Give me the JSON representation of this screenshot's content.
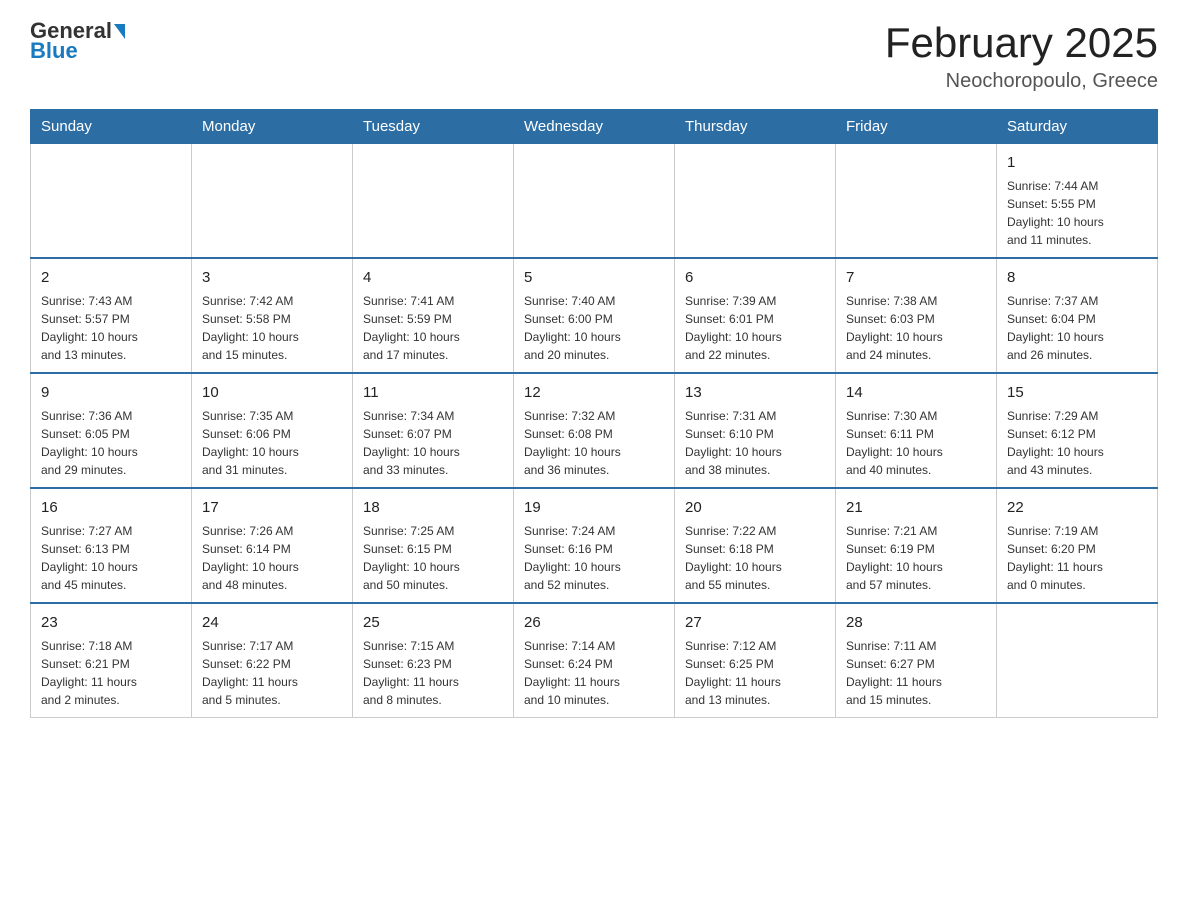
{
  "header": {
    "logo": {
      "general": "General",
      "blue": "Blue"
    },
    "title": "February 2025",
    "location": "Neochoropoulo, Greece"
  },
  "days_of_week": [
    "Sunday",
    "Monday",
    "Tuesday",
    "Wednesday",
    "Thursday",
    "Friday",
    "Saturday"
  ],
  "weeks": [
    [
      {
        "day": "",
        "info": ""
      },
      {
        "day": "",
        "info": ""
      },
      {
        "day": "",
        "info": ""
      },
      {
        "day": "",
        "info": ""
      },
      {
        "day": "",
        "info": ""
      },
      {
        "day": "",
        "info": ""
      },
      {
        "day": "1",
        "info": "Sunrise: 7:44 AM\nSunset: 5:55 PM\nDaylight: 10 hours\nand 11 minutes."
      }
    ],
    [
      {
        "day": "2",
        "info": "Sunrise: 7:43 AM\nSunset: 5:57 PM\nDaylight: 10 hours\nand 13 minutes."
      },
      {
        "day": "3",
        "info": "Sunrise: 7:42 AM\nSunset: 5:58 PM\nDaylight: 10 hours\nand 15 minutes."
      },
      {
        "day": "4",
        "info": "Sunrise: 7:41 AM\nSunset: 5:59 PM\nDaylight: 10 hours\nand 17 minutes."
      },
      {
        "day": "5",
        "info": "Sunrise: 7:40 AM\nSunset: 6:00 PM\nDaylight: 10 hours\nand 20 minutes."
      },
      {
        "day": "6",
        "info": "Sunrise: 7:39 AM\nSunset: 6:01 PM\nDaylight: 10 hours\nand 22 minutes."
      },
      {
        "day": "7",
        "info": "Sunrise: 7:38 AM\nSunset: 6:03 PM\nDaylight: 10 hours\nand 24 minutes."
      },
      {
        "day": "8",
        "info": "Sunrise: 7:37 AM\nSunset: 6:04 PM\nDaylight: 10 hours\nand 26 minutes."
      }
    ],
    [
      {
        "day": "9",
        "info": "Sunrise: 7:36 AM\nSunset: 6:05 PM\nDaylight: 10 hours\nand 29 minutes."
      },
      {
        "day": "10",
        "info": "Sunrise: 7:35 AM\nSunset: 6:06 PM\nDaylight: 10 hours\nand 31 minutes."
      },
      {
        "day": "11",
        "info": "Sunrise: 7:34 AM\nSunset: 6:07 PM\nDaylight: 10 hours\nand 33 minutes."
      },
      {
        "day": "12",
        "info": "Sunrise: 7:32 AM\nSunset: 6:08 PM\nDaylight: 10 hours\nand 36 minutes."
      },
      {
        "day": "13",
        "info": "Sunrise: 7:31 AM\nSunset: 6:10 PM\nDaylight: 10 hours\nand 38 minutes."
      },
      {
        "day": "14",
        "info": "Sunrise: 7:30 AM\nSunset: 6:11 PM\nDaylight: 10 hours\nand 40 minutes."
      },
      {
        "day": "15",
        "info": "Sunrise: 7:29 AM\nSunset: 6:12 PM\nDaylight: 10 hours\nand 43 minutes."
      }
    ],
    [
      {
        "day": "16",
        "info": "Sunrise: 7:27 AM\nSunset: 6:13 PM\nDaylight: 10 hours\nand 45 minutes."
      },
      {
        "day": "17",
        "info": "Sunrise: 7:26 AM\nSunset: 6:14 PM\nDaylight: 10 hours\nand 48 minutes."
      },
      {
        "day": "18",
        "info": "Sunrise: 7:25 AM\nSunset: 6:15 PM\nDaylight: 10 hours\nand 50 minutes."
      },
      {
        "day": "19",
        "info": "Sunrise: 7:24 AM\nSunset: 6:16 PM\nDaylight: 10 hours\nand 52 minutes."
      },
      {
        "day": "20",
        "info": "Sunrise: 7:22 AM\nSunset: 6:18 PM\nDaylight: 10 hours\nand 55 minutes."
      },
      {
        "day": "21",
        "info": "Sunrise: 7:21 AM\nSunset: 6:19 PM\nDaylight: 10 hours\nand 57 minutes."
      },
      {
        "day": "22",
        "info": "Sunrise: 7:19 AM\nSunset: 6:20 PM\nDaylight: 11 hours\nand 0 minutes."
      }
    ],
    [
      {
        "day": "23",
        "info": "Sunrise: 7:18 AM\nSunset: 6:21 PM\nDaylight: 11 hours\nand 2 minutes."
      },
      {
        "day": "24",
        "info": "Sunrise: 7:17 AM\nSunset: 6:22 PM\nDaylight: 11 hours\nand 5 minutes."
      },
      {
        "day": "25",
        "info": "Sunrise: 7:15 AM\nSunset: 6:23 PM\nDaylight: 11 hours\nand 8 minutes."
      },
      {
        "day": "26",
        "info": "Sunrise: 7:14 AM\nSunset: 6:24 PM\nDaylight: 11 hours\nand 10 minutes."
      },
      {
        "day": "27",
        "info": "Sunrise: 7:12 AM\nSunset: 6:25 PM\nDaylight: 11 hours\nand 13 minutes."
      },
      {
        "day": "28",
        "info": "Sunrise: 7:11 AM\nSunset: 6:27 PM\nDaylight: 11 hours\nand 15 minutes."
      },
      {
        "day": "",
        "info": ""
      }
    ]
  ]
}
